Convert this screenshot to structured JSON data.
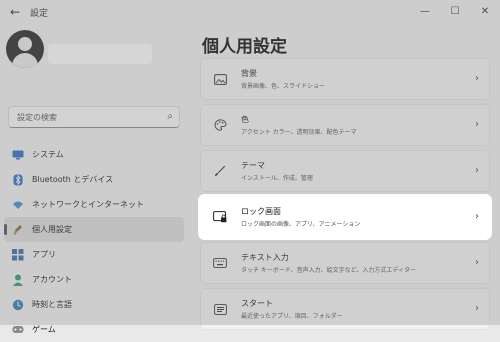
{
  "window": {
    "title": "設定"
  },
  "search": {
    "placeholder": "設定の検索"
  },
  "nav": [
    {
      "id": "system",
      "label": "システム"
    },
    {
      "id": "bluetooth",
      "label": "Bluetooth とデバイス"
    },
    {
      "id": "network",
      "label": "ネットワークとインターネット"
    },
    {
      "id": "personalization",
      "label": "個人用設定",
      "active": true
    },
    {
      "id": "apps",
      "label": "アプリ"
    },
    {
      "id": "accounts",
      "label": "アカウント"
    },
    {
      "id": "time",
      "label": "時刻と言語"
    },
    {
      "id": "gaming",
      "label": "ゲーム"
    }
  ],
  "page": {
    "title": "個人用設定"
  },
  "cards": [
    {
      "title": "背景",
      "subtitle": "背景画像、色、スライドショー"
    },
    {
      "title": "色",
      "subtitle": "アクセント カラー、透明効果、配色テーマ"
    },
    {
      "title": "テーマ",
      "subtitle": "インストール、作成、管理"
    },
    {
      "title": "ロック画面",
      "subtitle": "ロック画面の画像、アプリ、アニメーション"
    },
    {
      "title": "テキスト入力",
      "subtitle": "タッチ キーボード、音声入力、絵文字など、入力方式エディター"
    },
    {
      "title": "スタート",
      "subtitle": "最近使ったアプリ、項目、フォルダー"
    }
  ]
}
